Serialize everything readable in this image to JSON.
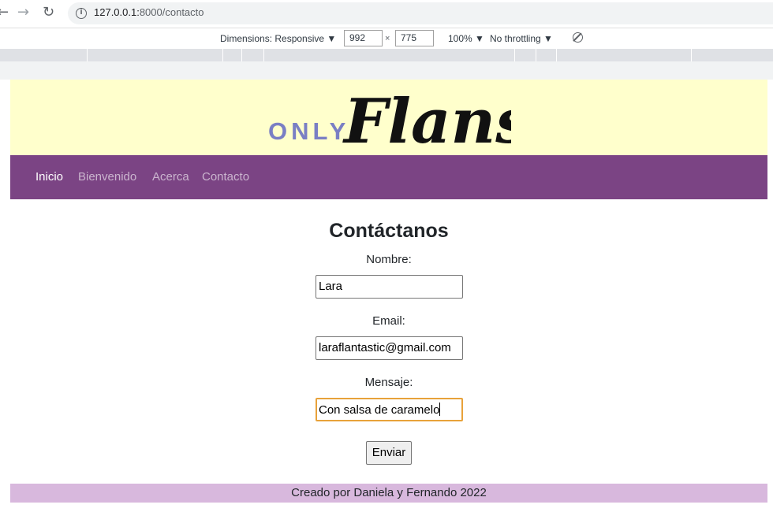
{
  "browser": {
    "url_host": "127.0.0.1:",
    "url_path": "8000/contacto",
    "nav_back_glyph": "←",
    "nav_forward_glyph": "→",
    "nav_reload_glyph": "↻"
  },
  "devtools": {
    "dimensions_label": "Dimensions: Responsive ▼",
    "width_value": "992",
    "times": "×",
    "height_value": "775",
    "zoom": "100% ▼",
    "throttling": "No throttling ▼"
  },
  "site": {
    "logo_prefix": "ONLY",
    "logo_script": "Flans",
    "colors": {
      "banner": "#ffffcc",
      "navbar": "#7b4484",
      "footer": "#d8b8dd",
      "logo_prefix": "#7a7fc4"
    },
    "nav": [
      {
        "label": "Inicio",
        "active": true
      },
      {
        "label": "Bienvenido",
        "active": false
      },
      {
        "label": "Acerca",
        "active": false
      },
      {
        "label": "Contacto",
        "active": false
      }
    ]
  },
  "form": {
    "title": "Contáctanos",
    "name_label": "Nombre:",
    "name_value": "Lara",
    "email_label": "Email:",
    "email_value": "laraflantastic@gmail.com",
    "message_label": "Mensaje:",
    "message_value": "Con salsa de caramelo",
    "submit_label": "Enviar"
  },
  "footer": {
    "text": "Creado por Daniela y Fernando 2022"
  }
}
